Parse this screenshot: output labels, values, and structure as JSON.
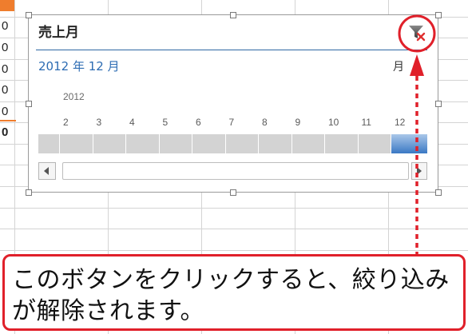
{
  "sheet": {
    "column_values": [
      "0",
      "0",
      "0",
      "0",
      "0",
      "0"
    ]
  },
  "timeline": {
    "title": "売上月",
    "selection_label": "2012 年 12 月",
    "time_level": "月",
    "year": "2012",
    "months": [
      "2",
      "3",
      "4",
      "5",
      "6",
      "7",
      "8",
      "9",
      "10",
      "11",
      "12"
    ],
    "selected_months": [
      "12"
    ]
  },
  "annotation": {
    "lines": [
      "このボタンをクリックすると、絞り込み",
      "が解除されます。"
    ]
  },
  "icons": {
    "clear_filter": "funnel-clear-icon",
    "scroll_left": "triangle-left-icon",
    "scroll_right": "triangle-right-icon"
  },
  "colors": {
    "accent": "#2d6cb3",
    "selected_segment": "#3a78c4",
    "unselected_segment": "#d3d3d3",
    "annotation_red": "#e0202a",
    "active_cell": "#ef7d2d"
  }
}
